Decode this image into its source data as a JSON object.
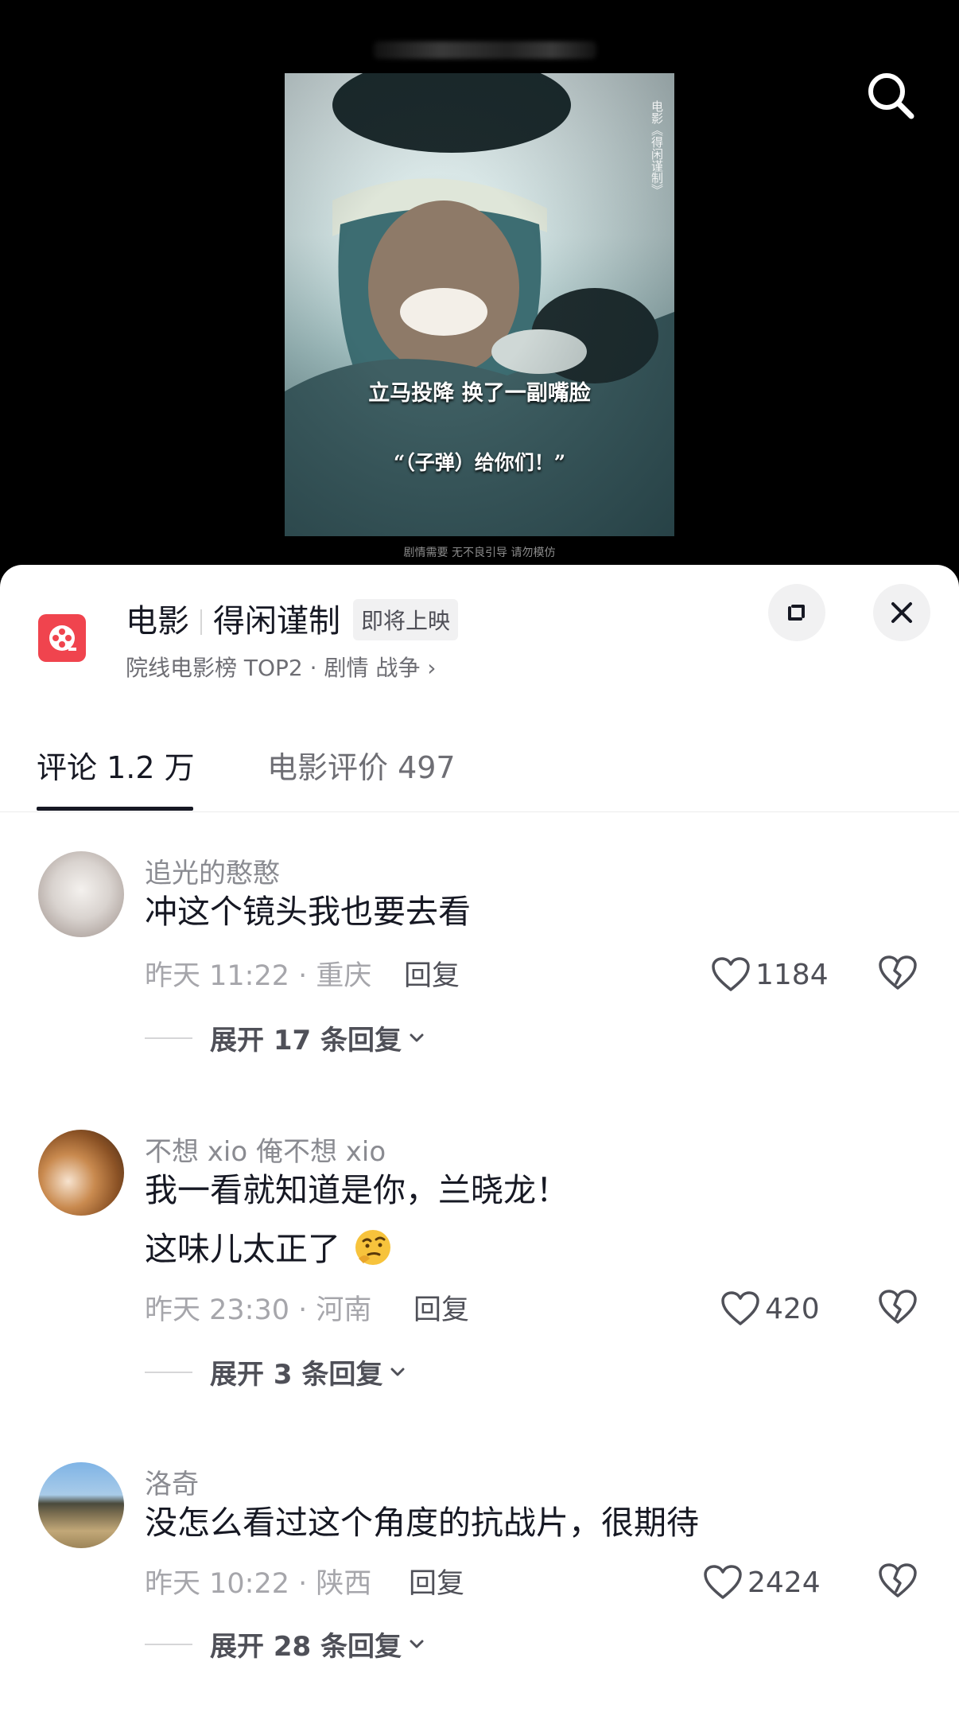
{
  "video": {
    "subtitle_line1": "立马投降 换了一副嘴脸",
    "subtitle_line2": "“（子弹）给你们！”",
    "vertical_tag": "电影《得闲谨制》",
    "disclaimer": "剧情需要 无不良引导 请勿模仿",
    "search_icon": "search-icon"
  },
  "movie": {
    "category": "电影",
    "title": "得闲谨制",
    "status_badge": "即将上映",
    "subtitle": "院线电影榜 TOP2 · 剧情 战争 ›",
    "icon": "film-reel-icon",
    "icon_color": "#f0444e"
  },
  "tabs": [
    {
      "label": "评论 1.2 万",
      "active": true
    },
    {
      "label": "电影评价 497",
      "active": false
    }
  ],
  "comments": [
    {
      "username": "追光的憨憨",
      "lines": [
        "冲这个镜头我也要去看"
      ],
      "time_location": "昨天 11:22 · 重庆",
      "reply_label": "回复",
      "likes": "1184",
      "expand_label": "展开 17 条回复"
    },
    {
      "username": "不想 xio 俺不想 xio",
      "lines": [
        "我一看就知道是你，兰晓龙！",
        "这味儿太正了"
      ],
      "emoji": "thinking-face-emoji",
      "time_location": "昨天 23:30 · 河南",
      "reply_label": "回复",
      "likes": "420",
      "expand_label": "展开 3 条回复"
    },
    {
      "username": "洛奇",
      "lines": [
        "没怎么看过这个角度的抗战片，很期待"
      ],
      "time_location": "昨天 10:22 · 陕西",
      "reply_label": "回复",
      "likes": "2424",
      "expand_label": "展开 28 条回复"
    }
  ]
}
